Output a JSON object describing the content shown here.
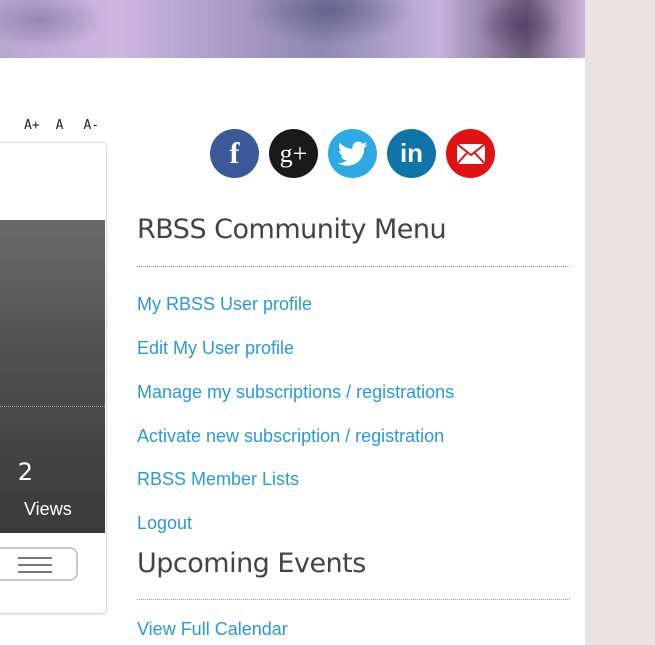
{
  "font_size_controls": {
    "increase": "A+",
    "normal": "A",
    "decrease": "A-"
  },
  "card": {
    "views_count": "2",
    "views_label": "Views"
  },
  "social": {
    "facebook_icon": "f",
    "googleplus_icon": "g+",
    "linkedin_icon": "in"
  },
  "community_menu": {
    "title": "RBSS Community Menu",
    "links": [
      "My RBSS User profile",
      "Edit My User profile",
      "Manage my subscriptions / registrations",
      "Activate new subscription / registration",
      "RBSS Member Lists",
      "Logout"
    ]
  },
  "events": {
    "title": "Upcoming Events",
    "calendar_link": "View Full Calendar"
  },
  "colors": {
    "link": "#2a9ad6",
    "facebook": "#3b5998",
    "googleplus": "#1a1a1a",
    "twitter": "#2fa9e1",
    "linkedin": "#0f74a8",
    "email": "#e01214"
  }
}
